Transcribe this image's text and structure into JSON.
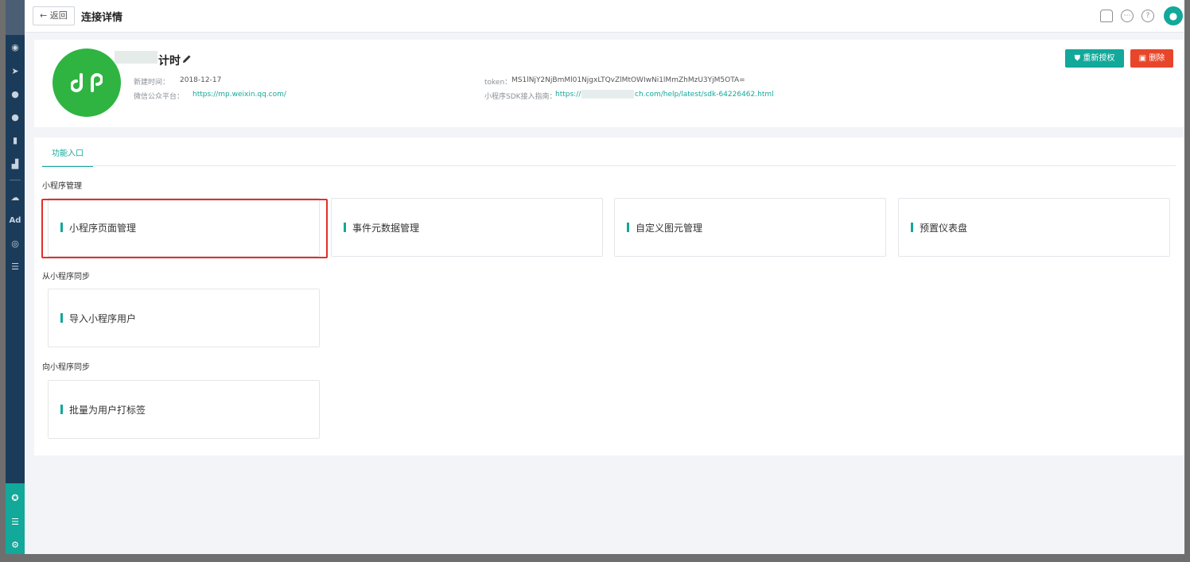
{
  "topbar": {
    "back_label": "← 返回",
    "title": "连接详情"
  },
  "app": {
    "name": "计时",
    "created_label": "新建时间：",
    "created_value": "2018-12-17",
    "wechat_label": "微信公众平台：",
    "wechat_link": "https://mp.weixin.qq.com/",
    "token_label": "token：",
    "token_value": "MS1lNjY2NjBmMl01NjgxLTQvZlMtOWIwNi1lMmZhMzU3YjM5OTA=",
    "sdk_label": "小程序SDK接入指南：",
    "sdk_link_start": "https://w",
    "sdk_link_end": "ch.com/help/latest/sdk-64226462.html"
  },
  "actions": {
    "reauth_label": "重新授权",
    "delete_label": "删除"
  },
  "tabs": [
    {
      "label": "功能入口",
      "active": true
    }
  ],
  "sections": [
    {
      "title": "小程序管理",
      "cards": [
        "小程序页面管理",
        "事件元数据管理",
        "自定义图元管理",
        "预置仪表盘"
      ]
    },
    {
      "title": "从小程序同步",
      "cards": [
        "导入小程序用户"
      ]
    },
    {
      "title": "向小程序同步",
      "cards": [
        "批量为用户打标签"
      ]
    }
  ],
  "colors": {
    "accent": "#12a89a",
    "danger": "#e8462a",
    "sidebar": "#1b3b5a",
    "highlight": "#e0302a",
    "app_icon": "#2fb442"
  },
  "icons": {
    "sidebar": [
      "dashboard-icon",
      "send-icon",
      "user-icon",
      "users-icon",
      "bookmark-icon",
      "bar-chart-icon",
      "wechat-icon",
      "ad-icon",
      "play-circle-icon",
      "list-icon"
    ],
    "sidebar_bottom": [
      "hub-icon",
      "server-icon",
      "gear-icon"
    ],
    "topbar": [
      "bell-icon",
      "chat-icon",
      "help-icon",
      "avatar-icon"
    ]
  }
}
